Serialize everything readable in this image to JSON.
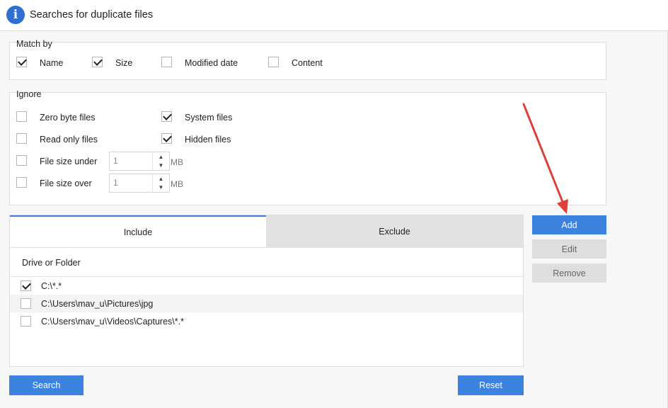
{
  "window": {
    "title": "Searches for duplicate files",
    "icon": "info-icon"
  },
  "match_by": {
    "label": "Match by",
    "options": [
      {
        "label": "Name",
        "checked": true
      },
      {
        "label": "Size",
        "checked": true
      },
      {
        "label": "Modified date",
        "checked": false
      },
      {
        "label": "Content",
        "checked": false
      }
    ]
  },
  "ignore": {
    "label": "Ignore",
    "zero_byte": {
      "label": "Zero byte files",
      "checked": false
    },
    "system_files": {
      "label": "System files",
      "checked": true
    },
    "read_only": {
      "label": "Read only files",
      "checked": false
    },
    "hidden_files": {
      "label": "Hidden files",
      "checked": true
    },
    "size_under": {
      "label": "File size under",
      "checked": false,
      "value": "1",
      "unit": "MB"
    },
    "size_over": {
      "label": "File size over",
      "checked": false,
      "value": "1",
      "unit": "MB"
    }
  },
  "tabs": [
    {
      "label": "Include",
      "active": true
    },
    {
      "label": "Exclude",
      "active": false
    }
  ],
  "list": {
    "header": "Drive or Folder",
    "rows": [
      {
        "path": "C:\\*.*",
        "checked": true
      },
      {
        "path": "C:\\Users\\mav_u\\Pictures\\jpg",
        "checked": false
      },
      {
        "path": "C:\\Users\\mav_u\\Videos\\Captures\\*.*",
        "checked": false
      }
    ]
  },
  "side_buttons": {
    "add": "Add",
    "edit": "Edit",
    "remove": "Remove"
  },
  "footer": {
    "search": "Search",
    "reset": "Reset"
  },
  "colors": {
    "accent": "#3c82df",
    "annotation_arrow": "#e0403a"
  }
}
